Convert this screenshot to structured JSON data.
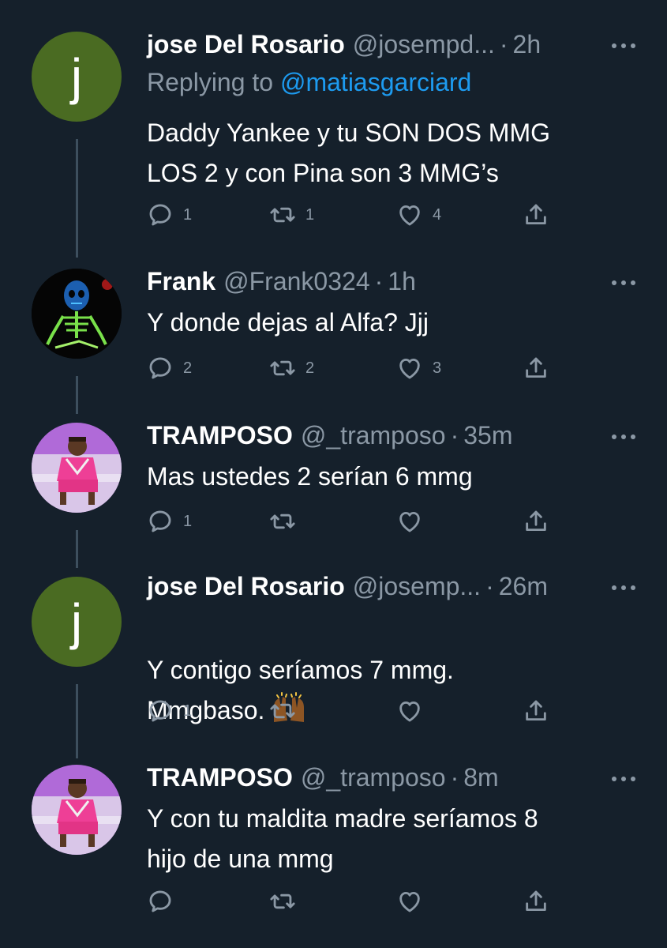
{
  "tweets": [
    {
      "name": "jose Del Rosario",
      "handle": "@josempd...",
      "time": "2h",
      "replying_label": "Replying to ",
      "replying_to": "@matiasgarciard",
      "text": "Daddy Yankee y tu SON DOS MMG\nLOS 2 y con Pina son 3 MMG’s",
      "avatar_letter": "j",
      "replies": "1",
      "retweets": "1",
      "likes": "4"
    },
    {
      "name": "Frank",
      "handle": "@Frank0324",
      "time": "1h",
      "text": "Y donde dejas al Alfa? Jjj",
      "replies": "2",
      "retweets": "2",
      "likes": "3"
    },
    {
      "name": "TRAMPOSO",
      "handle": "@_tramposo",
      "time": "35m",
      "text": "Mas ustedes 2 serían 6 mmg",
      "replies": "1",
      "retweets": "",
      "likes": ""
    },
    {
      "name": "jose Del Rosario",
      "handle": "@josemp...",
      "time": "26m",
      "text": "Y contigo seríamos 7 mmg.\nMmgbaso.",
      "emoji": "raising-hands",
      "avatar_letter": "j",
      "replies": "1",
      "retweets": "",
      "likes": ""
    },
    {
      "name": "TRAMPOSO",
      "handle": "@_tramposo",
      "time": "8m",
      "text": "Y con tu maldita madre seríamos 8\nhijo de una mmg",
      "replies": "",
      "retweets": "",
      "likes": ""
    }
  ],
  "separator": "·",
  "colors": {
    "background": "#15202b",
    "secondary_text": "#8b98a5",
    "link": "#1d9bf0",
    "thread_line": "#3d4f5e",
    "avatar_green": "#4a6b22"
  },
  "icons": [
    "reply-icon",
    "retweet-icon",
    "like-icon",
    "share-icon",
    "more-icon",
    "raising-hands-emoji"
  ]
}
